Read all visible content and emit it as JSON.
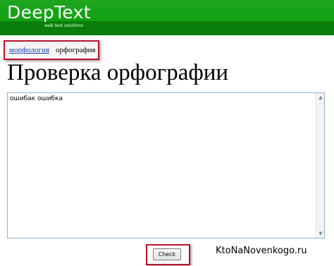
{
  "header": {
    "logo_text": "DeepText",
    "tagline": "web text solutions"
  },
  "tabs": {
    "link_label": "морфология",
    "active_label": "орфография"
  },
  "main": {
    "title": "Проверка орфографии",
    "textarea_value": "ошибак ошибка",
    "check_button_label": "Check"
  },
  "watermark": "KtoNaNovenkogo.ru",
  "icons": {
    "scroll_up": "scroll-up-arrow-icon",
    "scroll_down": "scroll-down-arrow-icon"
  },
  "colors": {
    "header_green": "#11a111",
    "highlight_red": "#b8152a",
    "link_blue": "#1a3fb0"
  }
}
